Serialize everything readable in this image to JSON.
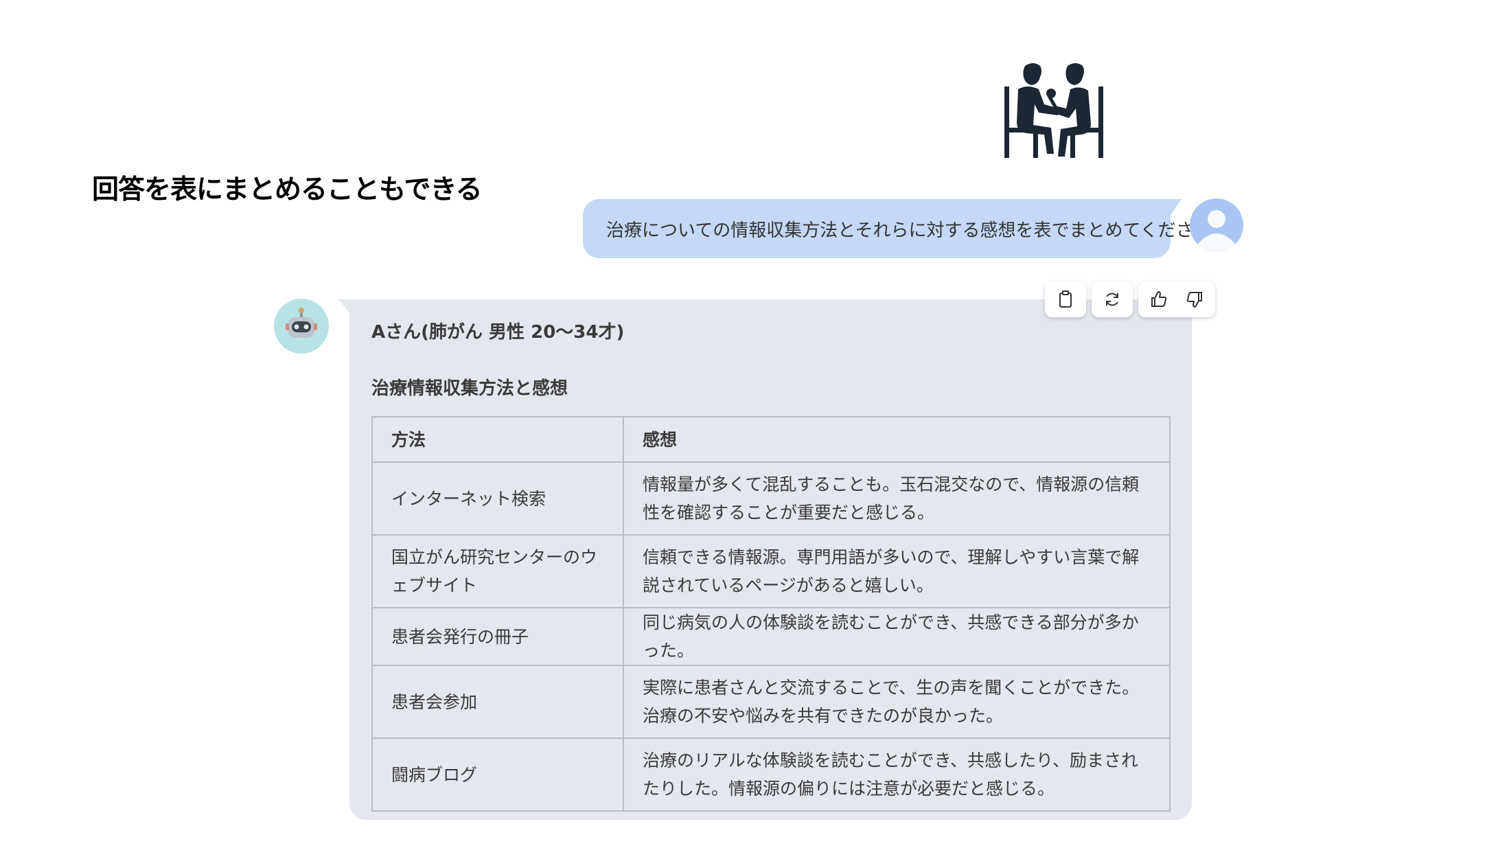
{
  "slide": {
    "title": "回答を表にまとめることもできる"
  },
  "user_message": {
    "text": "治療についての情報収集方法とそれらに対する感想を表でまとめてください"
  },
  "bot_message": {
    "patient_label": "Aさん(肺がん 男性 20〜34才)",
    "section_heading": "治療情報収集方法と感想",
    "table": {
      "headers": [
        "方法",
        "感想"
      ],
      "rows": [
        {
          "method": "インターネット検索",
          "impression": "情報量が多くて混乱することも。玉石混交なので、情報源の信頼性を確認することが重要だと感じる。"
        },
        {
          "method": "国立がん研究センターのウェブサイト",
          "impression": "信頼できる情報源。専門用語が多いので、理解しやすい言葉で解説されているページがあると嬉しい。"
        },
        {
          "method": "患者会発行の冊子",
          "impression": "同じ病気の人の体験談を読むことができ、共感できる部分が多かった。"
        },
        {
          "method": "患者会参加",
          "impression": "実際に患者さんと交流することで、生の声を聞くことができた。治療の不安や悩みを共有できたのが良かった。"
        },
        {
          "method": "闘病ブログ",
          "impression": "治療のリアルな体験談を読むことができ、共感したり、励まされたりした。情報源の偏りには注意が必要だと感じる。"
        }
      ]
    }
  },
  "actions": [
    "clipboard-icon",
    "refresh-icon",
    "thumbs-up-icon",
    "thumbs-down-icon"
  ],
  "colors": {
    "user_bubble": "#c4d8f7",
    "bot_bubble": "#e4e7ee",
    "bot_avatar_bg": "#b8e3e4",
    "user_avatar_bg": "#a9c6f2",
    "icon_dark": "#1d2733"
  }
}
